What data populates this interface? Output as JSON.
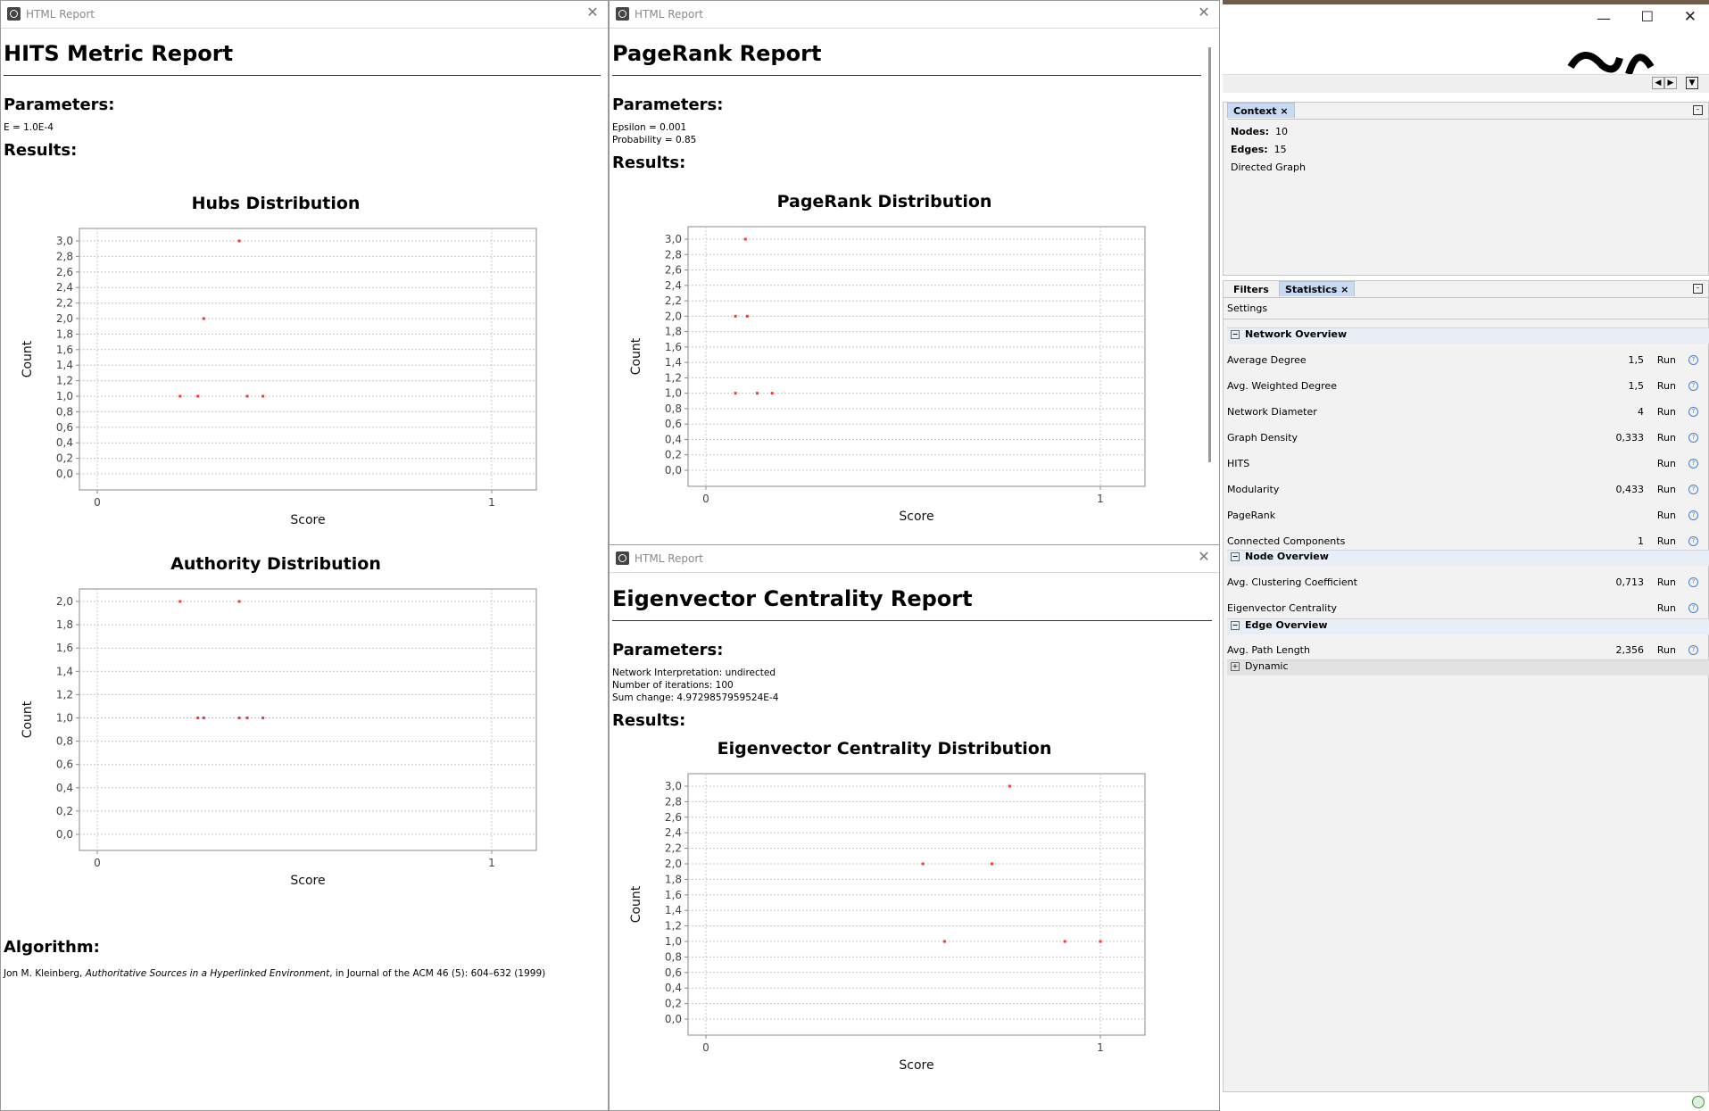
{
  "windows": {
    "hits": {
      "title": "HTML Report",
      "heading": "HITS Metric Report",
      "params_heading": "Parameters:",
      "params": [
        "E = 1.0E-4"
      ],
      "results_heading": "Results:",
      "algorithm_heading": "Algorithm:",
      "algorithm_author": "Jon M. Kleinberg, ",
      "algorithm_title": "Authoritative Sources in a Hyperlinked Environment",
      "algorithm_rest": ", in Journal of the ACM 46 (5): 604–632 (1999)"
    },
    "pagerank": {
      "title": "HTML Report",
      "heading": "PageRank Report",
      "params_heading": "Parameters:",
      "params": [
        "Epsilon = 0.001",
        "Probability = 0.85"
      ],
      "results_heading": "Results:"
    },
    "eigen": {
      "title": "HTML Report",
      "heading": "Eigenvector Centrality Report",
      "params_heading": "Parameters:",
      "params": [
        "Network Interpretation: undirected",
        "Number of iterations: 100",
        "Sum change: 4.9729857959524E-4"
      ],
      "results_heading": "Results:"
    }
  },
  "chart_data": [
    {
      "id": "hubs",
      "type": "scatter",
      "title": "Hubs Distribution",
      "xlabel": "Score",
      "ylabel": "Count",
      "xlim": [
        0,
        1
      ],
      "ylim": [
        0,
        3.0
      ],
      "x_ticks": [
        "0",
        "1"
      ],
      "y_ticks": [
        "0,0",
        "0,2",
        "0,4",
        "0,6",
        "0,8",
        "1,0",
        "1,2",
        "1,4",
        "1,6",
        "1,8",
        "2,0",
        "2,2",
        "2,4",
        "2,6",
        "2,8",
        "3,0"
      ],
      "points": [
        [
          0.36,
          3.0
        ],
        [
          0.27,
          2.0
        ],
        [
          0.21,
          1.0
        ],
        [
          0.255,
          1.0
        ],
        [
          0.38,
          1.0
        ],
        [
          0.42,
          1.0
        ]
      ],
      "color": "#ff3333"
    },
    {
      "id": "authority",
      "type": "scatter",
      "title": "Authority Distribution",
      "xlabel": "Score",
      "ylabel": "Count",
      "xlim": [
        0,
        1
      ],
      "ylim": [
        0,
        2.0
      ],
      "x_ticks": [
        "0",
        "1"
      ],
      "y_ticks": [
        "0,0",
        "0,2",
        "0,4",
        "0,6",
        "0,8",
        "1,0",
        "1,2",
        "1,4",
        "1,6",
        "1,8",
        "2,0"
      ],
      "points": [
        [
          0.21,
          2.0
        ],
        [
          0.36,
          2.0
        ],
        [
          0.255,
          1.0
        ],
        [
          0.27,
          1.0
        ],
        [
          0.36,
          1.0
        ],
        [
          0.38,
          1.0
        ],
        [
          0.42,
          1.0
        ]
      ],
      "color": "#ff3333"
    },
    {
      "id": "pagerank",
      "type": "scatter",
      "title": "PageRank Distribution",
      "xlabel": "Score",
      "ylabel": "Count",
      "xlim": [
        0,
        1
      ],
      "ylim": [
        0,
        3.0
      ],
      "x_ticks": [
        "0",
        "1"
      ],
      "y_ticks": [
        "0,0",
        "0,2",
        "0,4",
        "0,6",
        "0,8",
        "1,0",
        "1,2",
        "1,4",
        "1,6",
        "1,8",
        "2,0",
        "2,2",
        "2,4",
        "2,6",
        "2,8",
        "3,0"
      ],
      "points": [
        [
          0.1,
          3.0
        ],
        [
          0.075,
          2.0
        ],
        [
          0.105,
          2.0
        ],
        [
          0.075,
          1.0
        ],
        [
          0.13,
          1.0
        ],
        [
          0.168,
          1.0
        ]
      ],
      "color": "#ff3333"
    },
    {
      "id": "eigen",
      "type": "scatter",
      "title": "Eigenvector Centrality Distribution",
      "xlabel": "Score",
      "ylabel": "Count",
      "xlim": [
        0,
        1
      ],
      "ylim": [
        0,
        3.0
      ],
      "x_ticks": [
        "0",
        "1"
      ],
      "y_ticks": [
        "0,0",
        "0,2",
        "0,4",
        "0,6",
        "0,8",
        "1,0",
        "1,2",
        "1,4",
        "1,6",
        "1,8",
        "2,0",
        "2,2",
        "2,4",
        "2,6",
        "2,8",
        "3,0"
      ],
      "points": [
        [
          0.77,
          3.0
        ],
        [
          0.55,
          2.0
        ],
        [
          0.725,
          2.0
        ],
        [
          0.605,
          1.0
        ],
        [
          0.91,
          1.0
        ],
        [
          1.0,
          1.0
        ]
      ],
      "color": "#ff3333"
    }
  ],
  "context": {
    "tab_label": "Context",
    "nodes_label": "Nodes:",
    "nodes_value": "10",
    "edges_label": "Edges:",
    "edges_value": "15",
    "graph_type": "Directed Graph"
  },
  "stats_panel": {
    "tabs": [
      "Filters",
      "Statistics"
    ],
    "settings_label": "Settings",
    "groups": {
      "network": "Network Overview",
      "node": "Node Overview",
      "edge": "Edge Overview",
      "dynamic": "Dynamic"
    },
    "run_label": "Run",
    "rows": [
      {
        "label": "Average Degree",
        "value": "1,5"
      },
      {
        "label": "Avg. Weighted Degree",
        "value": "1,5"
      },
      {
        "label": "Network Diameter",
        "value": "4"
      },
      {
        "label": "Graph Density",
        "value": "0,333"
      },
      {
        "label": "HITS",
        "value": ""
      },
      {
        "label": "Modularity",
        "value": "0,433"
      },
      {
        "label": "PageRank",
        "value": ""
      },
      {
        "label": "Connected Components",
        "value": "1"
      },
      {
        "label": "Avg. Clustering Coefficient",
        "value": "0,713"
      },
      {
        "label": "Eigenvector Centrality",
        "value": ""
      },
      {
        "label": "Avg. Path Length",
        "value": "2,356"
      }
    ]
  }
}
